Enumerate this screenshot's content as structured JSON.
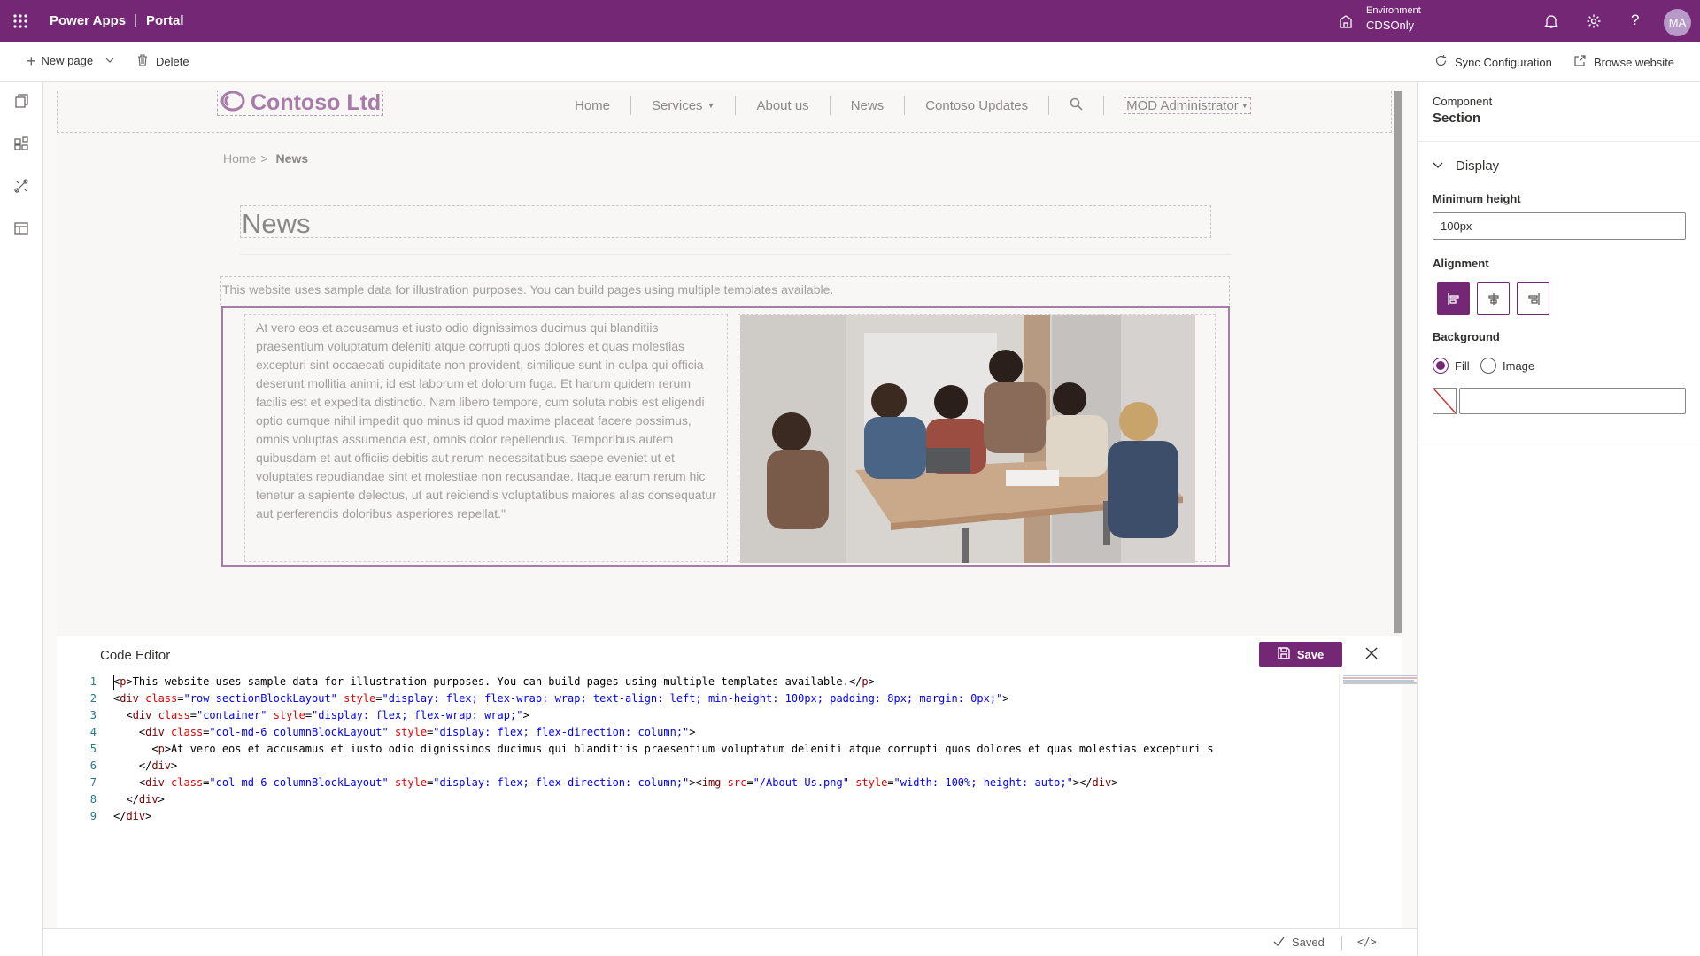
{
  "topbar": {
    "app_name": "Power Apps",
    "separator": "|",
    "product": "Portal",
    "env_label": "Environment",
    "env_value": "CDSOnly",
    "avatar": "MA",
    "icons": [
      "waffle-icon",
      "environment-icon",
      "bell-icon",
      "gear-icon",
      "help-icon"
    ]
  },
  "cmdbar": {
    "new_page": "New page",
    "delete": "Delete",
    "sync": "Sync Configuration",
    "browse": "Browse website"
  },
  "site": {
    "logo": "Contoso Ltd",
    "nav": [
      "Home",
      "Services",
      "About us",
      "News",
      "Contoso Updates"
    ],
    "user": "MOD Administrator",
    "breadcrumb_home": "Home",
    "breadcrumb_sep": ">",
    "breadcrumb_current": "News",
    "heading": "News",
    "intro": "This website uses sample data for illustration purposes. You can build pages using multiple templates available.",
    "body": "At vero eos et accusamus et iusto odio dignissimos ducimus qui blanditiis praesentium voluptatum deleniti atque corrupti quos dolores et quas molestias excepturi sint occaecati cupiditate non provident, similique sunt in culpa qui officia deserunt mollitia animi, id est laborum et dolorum fuga. Et harum quidem rerum facilis est et expedita distinctio. Nam libero tempore, cum soluta nobis est eligendi optio cumque nihil impedit quo minus id quod maxime placeat facere possimus, omnis voluptas assumenda est, omnis dolor repellendus. Temporibus autem quibusdam et aut officiis debitis aut rerum necessitatibus saepe eveniet ut et voluptates repudiandae sint et molestiae non recusandae. Itaque earum rerum hic tenetur a sapiente delectus, ut aut reiciendis voluptatibus maiores alias consequatur aut perferendis doloribus asperiores repellat.\""
  },
  "editor": {
    "title": "Code Editor",
    "save": "Save",
    "line_numbers": [
      "1",
      "2",
      "3",
      "4",
      "5",
      "6",
      "7",
      "8",
      "9"
    ],
    "lines": [
      [
        [
          "t",
          "<"
        ],
        [
          "k",
          "p"
        ],
        [
          "t",
          ">This website uses sample data for illustration purposes. You can build pages using multiple templates available.</"
        ],
        [
          "k",
          "p"
        ],
        [
          "t",
          ">"
        ]
      ],
      [
        [
          "t",
          "<"
        ],
        [
          "k",
          "div"
        ],
        [
          "t",
          " "
        ],
        [
          "a",
          "class"
        ],
        [
          "t",
          "="
        ],
        [
          "s",
          "\"row sectionBlockLayout\""
        ],
        [
          "t",
          " "
        ],
        [
          "a",
          "style"
        ],
        [
          "t",
          "="
        ],
        [
          "s",
          "\"display: flex; flex-wrap: wrap; text-align: left; min-height: 100px; padding: 8px; margin: 0px;\""
        ],
        [
          "t",
          ">"
        ]
      ],
      [
        [
          "t",
          "  <"
        ],
        [
          "k",
          "div"
        ],
        [
          "t",
          " "
        ],
        [
          "a",
          "class"
        ],
        [
          "t",
          "="
        ],
        [
          "s",
          "\"container\""
        ],
        [
          "t",
          " "
        ],
        [
          "a",
          "style"
        ],
        [
          "t",
          "="
        ],
        [
          "s",
          "\"display: flex; flex-wrap: wrap;\""
        ],
        [
          "t",
          ">"
        ]
      ],
      [
        [
          "t",
          "    <"
        ],
        [
          "k",
          "div"
        ],
        [
          "t",
          " "
        ],
        [
          "a",
          "class"
        ],
        [
          "t",
          "="
        ],
        [
          "s",
          "\"col-md-6 columnBlockLayout\""
        ],
        [
          "t",
          " "
        ],
        [
          "a",
          "style"
        ],
        [
          "t",
          "="
        ],
        [
          "s",
          "\"display: flex; flex-direction: column;\""
        ],
        [
          "t",
          ">"
        ]
      ],
      [
        [
          "t",
          "      <"
        ],
        [
          "k",
          "p"
        ],
        [
          "t",
          ">At vero eos et accusamus et iusto odio dignissimos ducimus qui blanditiis praesentium voluptatum deleniti atque corrupti quos dolores et quas molestias excepturi s"
        ]
      ],
      [
        [
          "t",
          "    </"
        ],
        [
          "k",
          "div"
        ],
        [
          "t",
          ">"
        ]
      ],
      [
        [
          "t",
          "    <"
        ],
        [
          "k",
          "div"
        ],
        [
          "t",
          " "
        ],
        [
          "a",
          "class"
        ],
        [
          "t",
          "="
        ],
        [
          "s",
          "\"col-md-6 columnBlockLayout\""
        ],
        [
          "t",
          " "
        ],
        [
          "a",
          "style"
        ],
        [
          "t",
          "="
        ],
        [
          "s",
          "\"display: flex; flex-direction: column;\""
        ],
        [
          "t",
          "><"
        ],
        [
          "k",
          "img"
        ],
        [
          "t",
          " "
        ],
        [
          "a",
          "src"
        ],
        [
          "t",
          "="
        ],
        [
          "s",
          "\"/About Us.png\""
        ],
        [
          "t",
          " "
        ],
        [
          "a",
          "style"
        ],
        [
          "t",
          "="
        ],
        [
          "s",
          "\"width: 100%; height: auto;\""
        ],
        [
          "t",
          "></"
        ],
        [
          "k",
          "div"
        ],
        [
          "t",
          ">"
        ]
      ],
      [
        [
          "t",
          "  </"
        ],
        [
          "k",
          "div"
        ],
        [
          "t",
          ">"
        ]
      ],
      [
        [
          "t",
          "</"
        ],
        [
          "k",
          "div"
        ],
        [
          "t",
          ">"
        ]
      ]
    ]
  },
  "status": {
    "saved": "Saved",
    "code_toggle": "</>"
  },
  "panel": {
    "component_label": "Component",
    "component_value": "Section",
    "display_header": "Display",
    "min_height_label": "Minimum height",
    "min_height_value": "100px",
    "alignment_label": "Alignment",
    "alignment_options": [
      "align-left",
      "align-center",
      "align-right"
    ],
    "alignment_selected": "align-left",
    "background_label": "Background",
    "bg_fill": "Fill",
    "bg_image": "Image",
    "bg_selected": "Fill",
    "color_value": ""
  },
  "colors": {
    "brand": "#742774",
    "accent_light": "#a87ca8"
  }
}
